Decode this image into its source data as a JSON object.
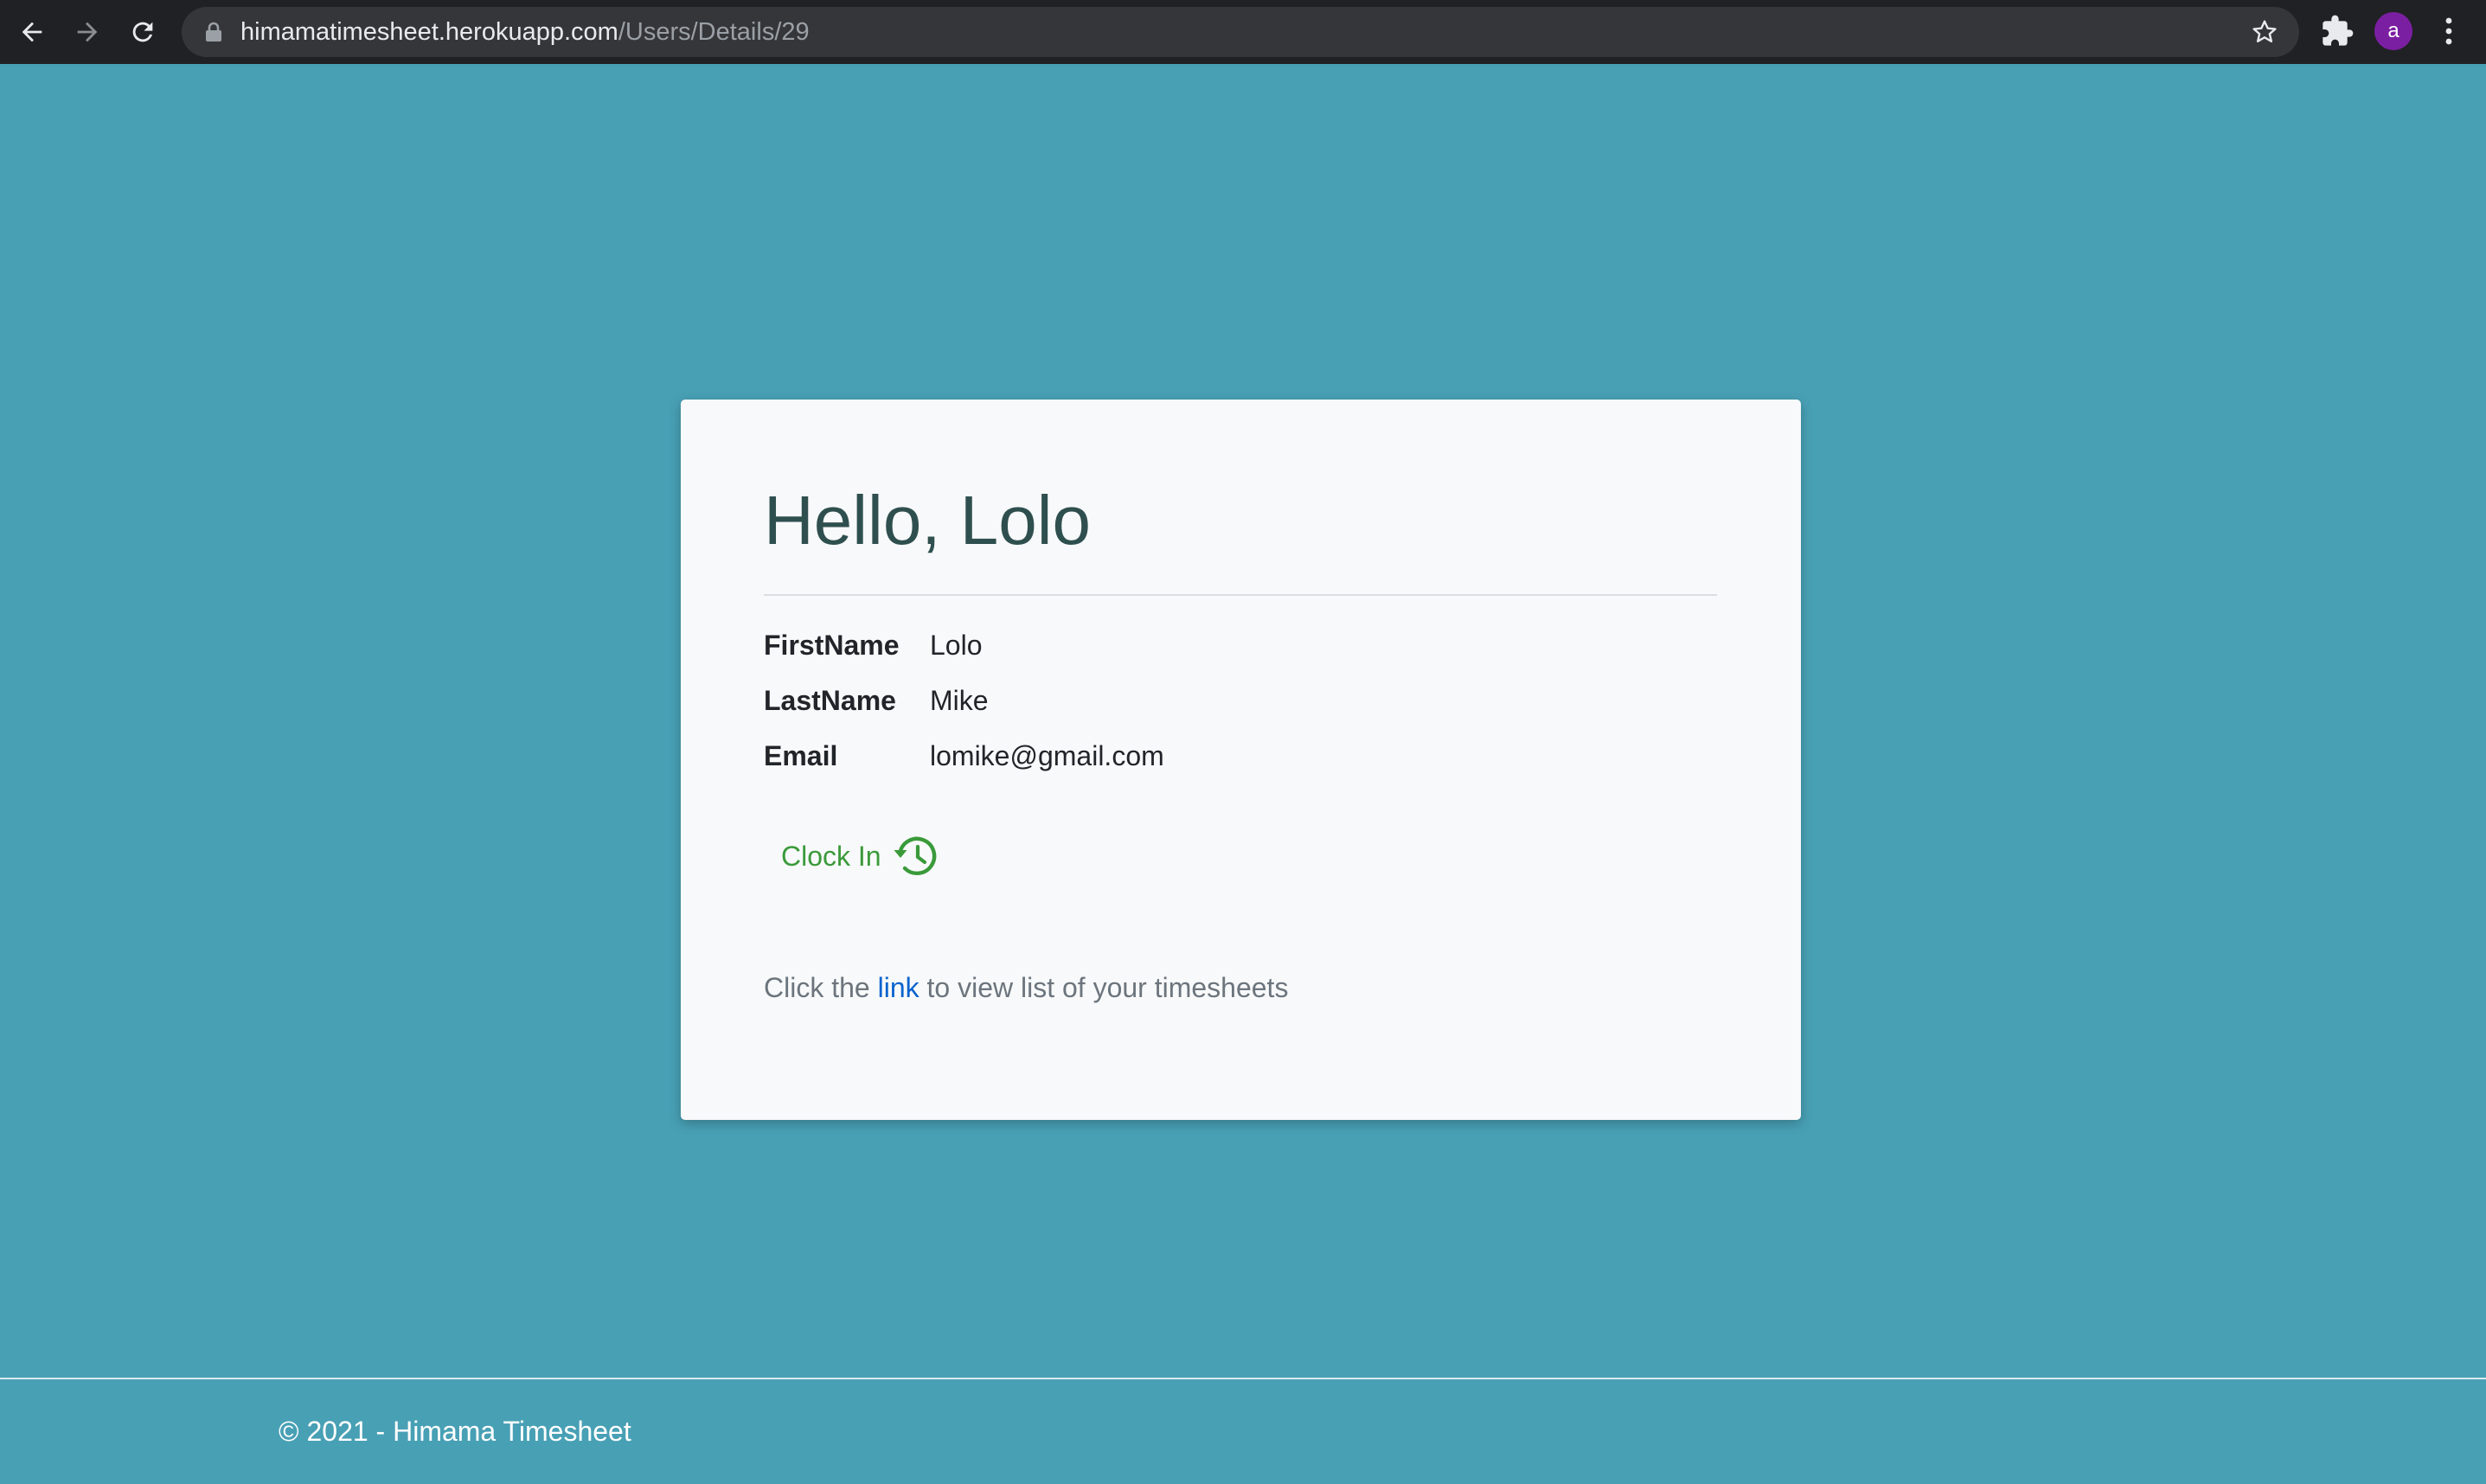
{
  "browser": {
    "url_host": "himamatimesheet.herokuapp.com",
    "url_path": "/Users/Details/29",
    "profile_initial": "a"
  },
  "card": {
    "title": "Hello, Lolo",
    "fields": [
      {
        "label": "FirstName",
        "value": "Lolo"
      },
      {
        "label": "LastName",
        "value": "Mike"
      },
      {
        "label": "Email",
        "value": "lomike@gmail.com"
      }
    ],
    "clock_in_label": "Clock In",
    "hint_before": "Click the ",
    "hint_link": "link",
    "hint_after": " to view list of your timesheets"
  },
  "footer": {
    "text": "© 2021 - Himama Timesheet"
  },
  "colors": {
    "page_background": "#48a0b5",
    "card_background": "#f8f9fa",
    "title_color": "#2f4f4f",
    "clock_in_color": "#3a9a3a",
    "link_color": "#0b63ce",
    "avatar_color": "#7b1fa2"
  },
  "icons": {
    "back": "arrow-left-icon",
    "forward": "arrow-right-icon",
    "reload": "reload-icon",
    "lock": "lock-icon",
    "bookmark": "star-icon",
    "extensions": "puzzle-icon",
    "menu": "kebab-menu-icon",
    "clock_in": "clock-history-icon"
  }
}
